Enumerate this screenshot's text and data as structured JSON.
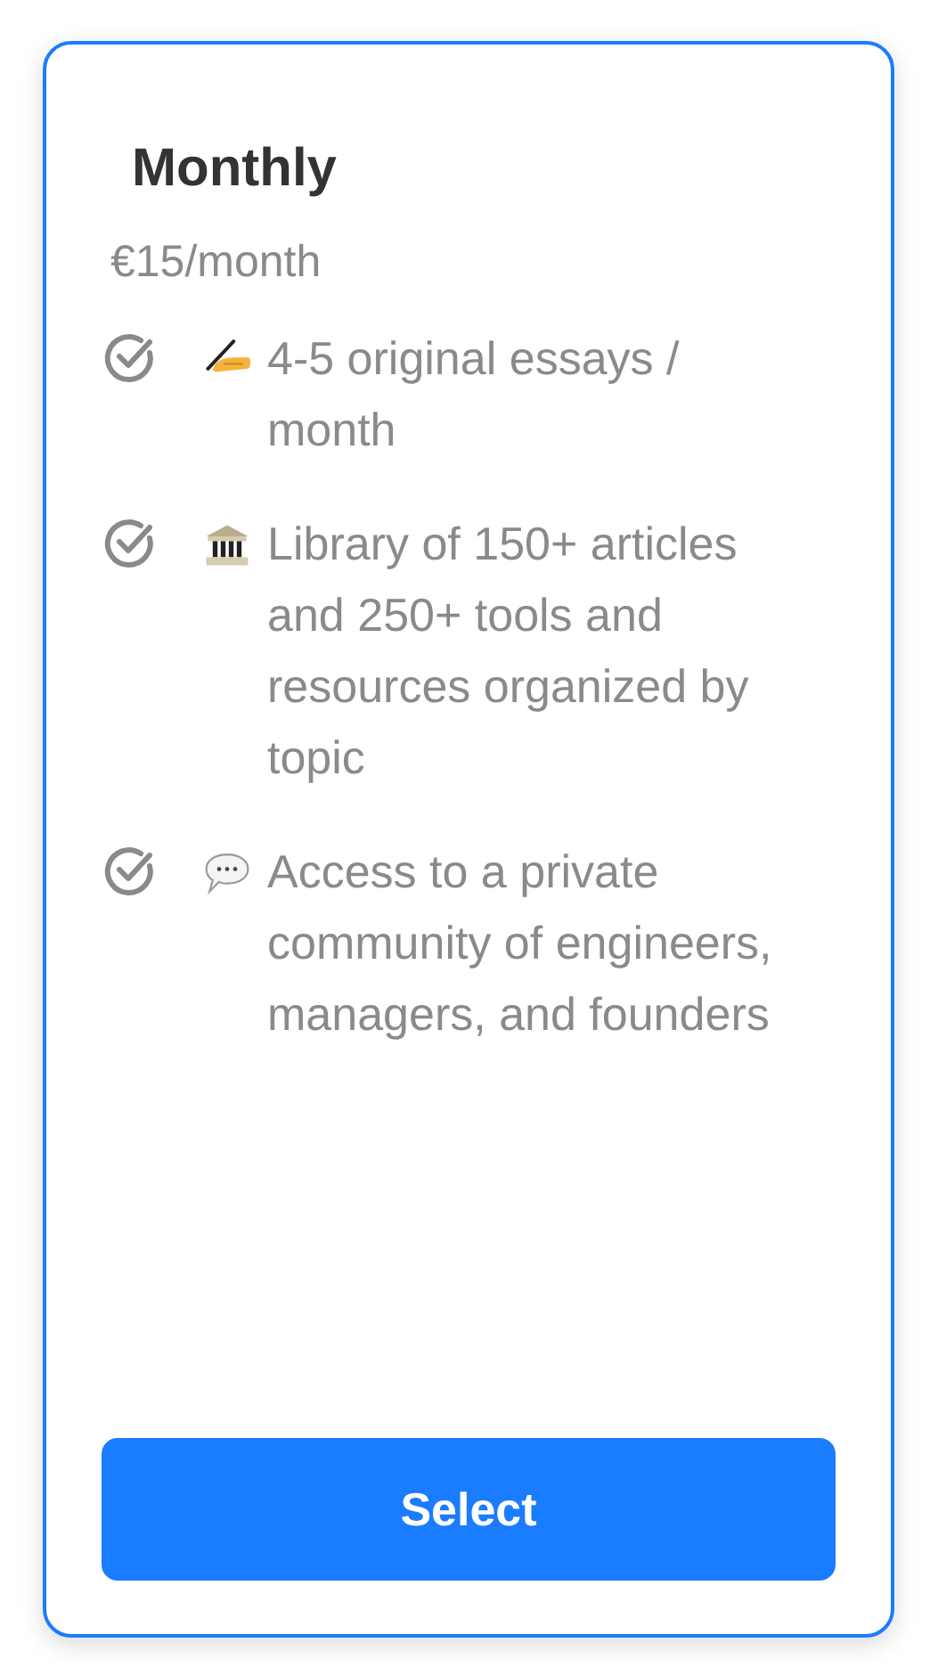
{
  "plan": {
    "title": "Monthly",
    "price": "€15/month",
    "selected": true
  },
  "features": [
    {
      "kind": "writing",
      "checked": true,
      "text": "4-5 original essays / month"
    },
    {
      "kind": "library",
      "checked": true,
      "text": "Library of 150+ articles and 250+ tools and resources organized by topic"
    },
    {
      "kind": "chat",
      "checked": true,
      "text": "Access to a private community of engineers, managers, and founders"
    }
  ],
  "button": {
    "label": "Select"
  }
}
